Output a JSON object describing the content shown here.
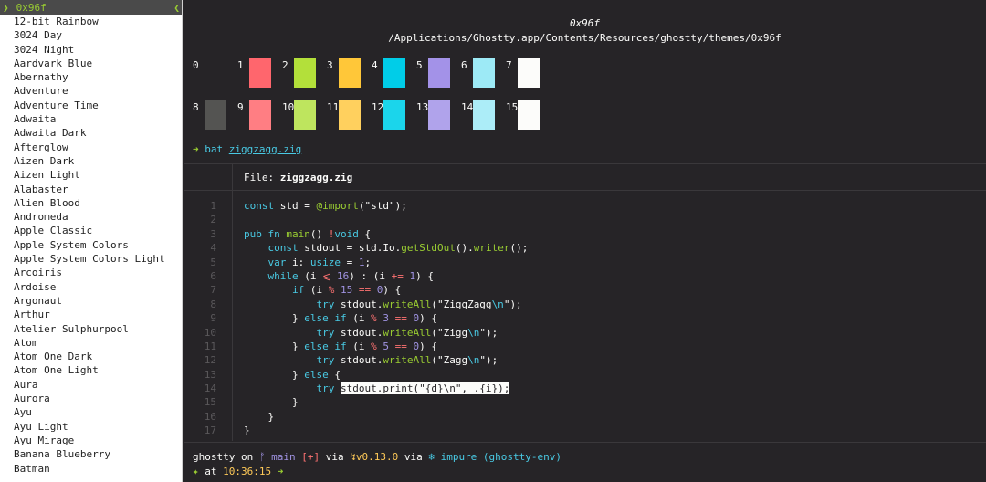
{
  "theme_list": {
    "selected": "0x96f",
    "items": [
      "12-bit Rainbow",
      "3024 Day",
      "3024 Night",
      "Aardvark Blue",
      "Abernathy",
      "Adventure",
      "Adventure Time",
      "Adwaita",
      "Adwaita Dark",
      "Afterglow",
      "Aizen Dark",
      "Aizen Light",
      "Alabaster",
      "Alien Blood",
      "Andromeda",
      "Apple Classic",
      "Apple System Colors",
      "Apple System Colors Light",
      "Arcoiris",
      "Ardoise",
      "Argonaut",
      "Arthur",
      "Atelier Sulphurpool",
      "Atom",
      "Atom One Dark",
      "Atom One Light",
      "Aura",
      "Aurora",
      "Ayu",
      "Ayu Light",
      "Ayu Mirage",
      "Banana Blueberry",
      "Batman"
    ]
  },
  "preview": {
    "theme_name": "0x96f",
    "theme_path": "/Applications/Ghostty.app/Contents/Resources/ghostty/themes/0x96f",
    "palette_row1": [
      {
        "n": "0",
        "color": "#262427"
      },
      {
        "n": "1",
        "color": "#ff666d"
      },
      {
        "n": "2",
        "color": "#b3e03a"
      },
      {
        "n": "3",
        "color": "#ffc739"
      },
      {
        "n": "4",
        "color": "#00cde8"
      },
      {
        "n": "5",
        "color": "#a392e8"
      },
      {
        "n": "6",
        "color": "#9deaf6"
      },
      {
        "n": "7",
        "color": "#fcfcfa"
      }
    ],
    "palette_row2": [
      {
        "n": "8",
        "color": "#545452"
      },
      {
        "n": "9",
        "color": "#ff7e83"
      },
      {
        "n": "10",
        "color": "#bee55e"
      },
      {
        "n": "11",
        "color": "#ffd05e"
      },
      {
        "n": "12",
        "color": "#1bd5eb"
      },
      {
        "n": "13",
        "color": "#b0a3eb"
      },
      {
        "n": "14",
        "color": "#acedf8"
      },
      {
        "n": "15",
        "color": "#fcfcfa"
      }
    ],
    "bat_arrow": "➜",
    "bat_cmd": "bat",
    "bat_arg": "ziggzagg.zig",
    "file_prefix": "File:",
    "file_name": "ziggzagg.zig",
    "line_numbers": [
      "1",
      "2",
      "3",
      "4",
      "5",
      "6",
      "7",
      "8",
      "9",
      "10",
      "11",
      "12",
      "13",
      "14",
      "15",
      "16",
      "17"
    ],
    "prompt": {
      "dir": "ghostty",
      "on": "on",
      "branch": " main",
      "flags": "[+]",
      "via1": "via",
      "zig": "↯v0.13.0",
      "via2": "via",
      "nix": "❄ impure (ghostty-env)",
      "star": "✦",
      "at": "at",
      "time": "10:36:15",
      "arrow": "➜"
    }
  },
  "colors": {
    "background": "#262427",
    "foreground": "#fcfcfa",
    "selection_bg": "#4a4a4a",
    "selection_fg": "#9acd32"
  }
}
